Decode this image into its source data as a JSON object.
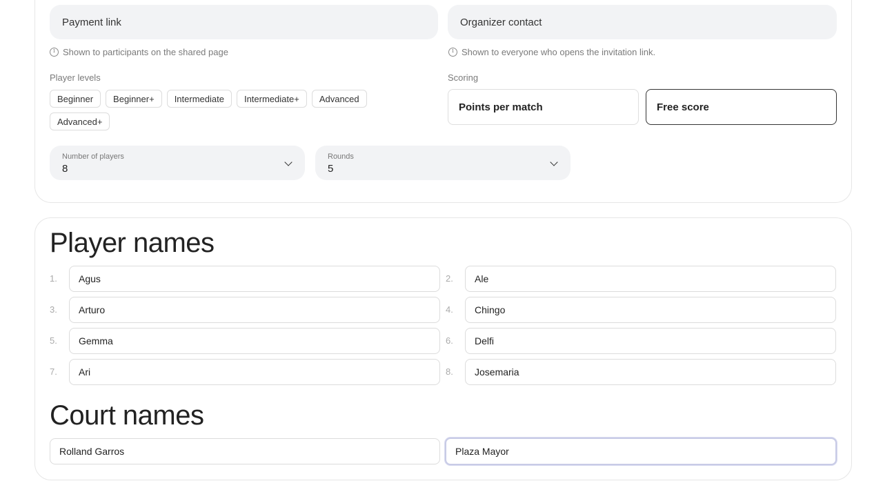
{
  "settings": {
    "payment_link_placeholder": "Payment link",
    "payment_hint": "Shown to participants on the shared page",
    "organizer_contact_placeholder": "Organizer contact",
    "organizer_hint": "Shown to everyone who opens the invitation link.",
    "player_levels_label": "Player levels",
    "levels": [
      "Beginner",
      "Beginner+",
      "Intermediate",
      "Intermediate+",
      "Advanced",
      "Advanced+"
    ],
    "scoring_label": "Scoring",
    "scoring_options": [
      "Points per match",
      "Free score"
    ],
    "scoring_selected": "Free score",
    "players_select": {
      "label": "Number of players",
      "value": "8"
    },
    "rounds_select": {
      "label": "Rounds",
      "value": "5"
    }
  },
  "players": {
    "heading": "Player names",
    "numbers": [
      "1.",
      "2.",
      "3.",
      "4.",
      "5.",
      "6.",
      "7.",
      "8."
    ],
    "names": [
      "Agus",
      "Ale",
      "Arturo",
      "Chingo",
      "Gemma",
      "Delfi",
      "Ari",
      "Josemaria"
    ]
  },
  "courts": {
    "heading": "Court names",
    "names": [
      "Rolland Garros",
      "Plaza Mayor"
    ]
  }
}
